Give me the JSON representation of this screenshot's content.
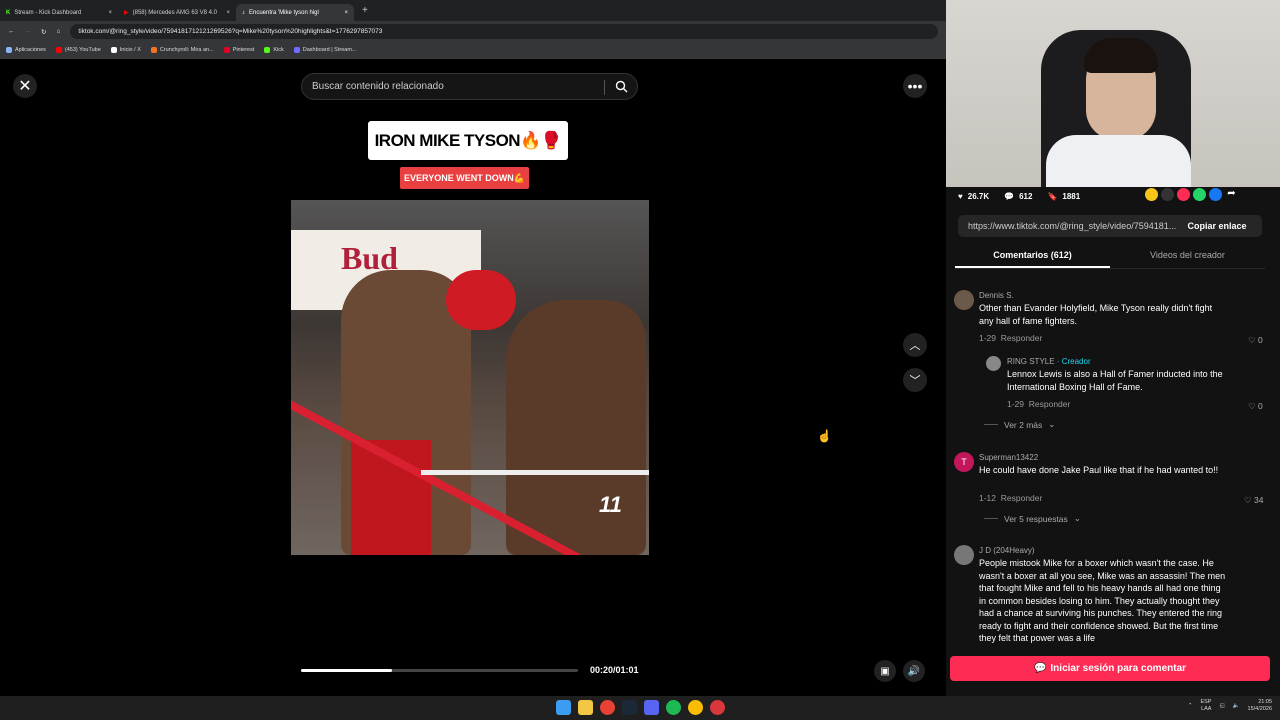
{
  "browser": {
    "tabs": [
      {
        "label": "Stream - Kick Dashboard",
        "color": "#53fc18"
      },
      {
        "label": "(858) Mercedes AMG 63 V8 4.0",
        "color": "#ff0000"
      },
      {
        "label": "Encuentra 'Mike tyson higl",
        "color": "#ffffff"
      }
    ],
    "url": "tiktok.com/@ring_style/video/7594181712121269526?q=Mike%20tyson%20highlights&t=1776297857073",
    "bookmarks": [
      {
        "label": "Aplicaciones",
        "color": "#8ab4f8"
      },
      {
        "label": "(453) YouTube",
        "color": "#ff0000"
      },
      {
        "label": "Inicio / X",
        "color": "#ffffff"
      },
      {
        "label": "Crunchyroll: Mira an...",
        "color": "#f47521"
      },
      {
        "label": "Pinterest",
        "color": "#e60023"
      },
      {
        "label": "Kick",
        "color": "#53fc18"
      },
      {
        "label": "Dashboard | Stream...",
        "color": "#6f6fff"
      }
    ]
  },
  "player": {
    "search_placeholder": "Buscar contenido relacionado",
    "video_title": "IRON MIKE TYSON🔥🥊",
    "video_subtitle": "EVERYONE WENT DOWN💪",
    "banner_text": "Bud",
    "score_text": "11",
    "progress": 0.33,
    "time": "00:20/01:01"
  },
  "stats": {
    "likes": "26.7K",
    "comments": "612",
    "saves": "1881"
  },
  "share": {
    "link": "https://www.tiktok.com/@ring_style/video/7594181...",
    "copy_label": "Copiar enlace"
  },
  "tabs": {
    "comments": "Comentarios (612)",
    "creator_videos": "Videos del creador"
  },
  "comments": [
    {
      "user": "Dennis S.",
      "text": "Other than Evander Holyfield, Mike Tyson really didn't fight any hall of fame fighters.",
      "date": "1-29",
      "reply": "Responder",
      "likes": "0",
      "avatar_color": "#6b5a4a"
    },
    {
      "user": "RING STYLE",
      "creator": "· Creador",
      "text": "Lennox Lewis is also a Hall of Famer inducted into the International Boxing Hall of Fame.",
      "date": "1-29",
      "reply": "Responder",
      "likes": "0",
      "avatar_color": "#888"
    },
    {
      "user": "Superman13422",
      "initial": "T",
      "text": "He could have done Jake Paul like that if he had wanted to!!",
      "date": "1-12",
      "reply": "Responder",
      "likes": "34",
      "avatar_color": "#c2185b"
    },
    {
      "user": "J D (204Heavy)",
      "text": "People mistook Mike for a boxer which wasn't the case. He wasn't a boxer at all you see, Mike was an assassin! The men that fought Mike and fell to his heavy hands all had one thing in common besides losing to him. They actually thought they had a chance at surviving his punches. They entered the ring ready to fight and their confidence showed. But the first time they felt that power was a life",
      "avatar_color": "#777"
    }
  ],
  "view_more": [
    "Ver 2 más",
    "Ver 5 respuestas"
  ],
  "login_label": "Iniciar sesión para comentar",
  "taskbar": {
    "lang": "ESP",
    "lang2": "LAA",
    "time": "21:05",
    "date": "15/4/2026"
  }
}
